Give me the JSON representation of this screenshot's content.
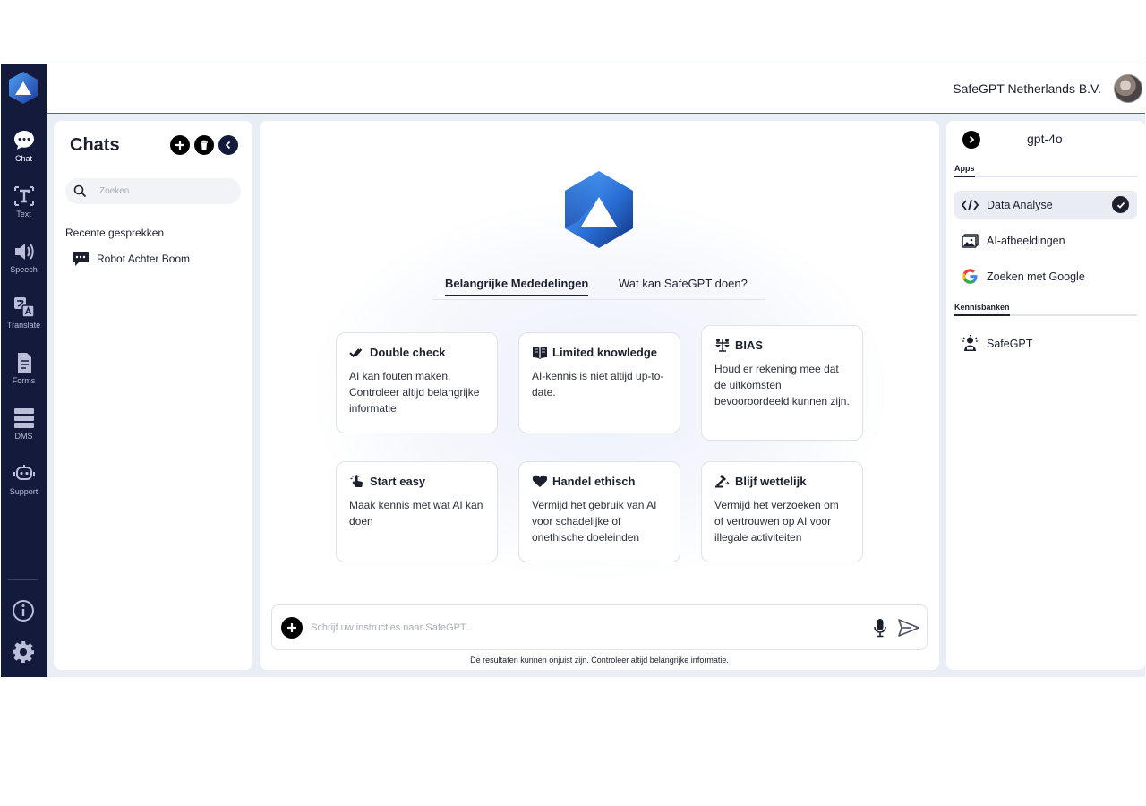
{
  "topbar": {
    "organization": "SafeGPT Netherlands B.V."
  },
  "rail": {
    "items": [
      {
        "label": "Chat",
        "icon": "chat-bubble-icon"
      },
      {
        "label": "Text",
        "icon": "text-icon"
      },
      {
        "label": "Speech",
        "icon": "speaker-icon"
      },
      {
        "label": "Translate",
        "icon": "translate-icon"
      },
      {
        "label": "Forms",
        "icon": "form-document-icon"
      },
      {
        "label": "DMS",
        "icon": "database-icon"
      },
      {
        "label": "Support",
        "icon": "support-robot-icon"
      }
    ],
    "bottom": [
      "info-icon",
      "gear-icon"
    ]
  },
  "chats": {
    "title": "Chats",
    "search_placeholder": "Zoeken",
    "recent_heading": "Recente gesprekken",
    "conversations": [
      {
        "title": "Robot Achter Boom"
      }
    ]
  },
  "main": {
    "tabs": [
      {
        "label": "Belangrijke Mededelingen",
        "active": true
      },
      {
        "label": "Wat kan SafeGPT doen?",
        "active": false
      }
    ],
    "cards": [
      {
        "title": "Double check",
        "body": "AI kan fouten maken. Controleer altijd belangrijke informatie.",
        "icon": "double-check-icon"
      },
      {
        "title": "Limited knowledge",
        "body": "AI-kennis is niet altijd up-to-date.",
        "icon": "book-icon"
      },
      {
        "title": "BIAS",
        "body": "Houd er rekening mee dat de uitkomsten bevooroordeeld kunnen zijn.",
        "icon": "scale-people-icon"
      },
      {
        "title": "Start easy",
        "body": "Maak kennis met wat AI kan doen",
        "icon": "tap-hand-icon"
      },
      {
        "title": "Handel ethisch",
        "body": "Vermijd het gebruik van AI voor schadelijke of onethische doeleinden",
        "icon": "heart-icon"
      },
      {
        "title": "Blijf wettelijk",
        "body": "Vermijd het verzoeken om of vertrouwen op AI voor illegale activiteiten",
        "icon": "gavel-icon"
      }
    ],
    "composer_placeholder": "Schrijf uw instructies naar SafeGPT...",
    "disclaimer": "De resultaten kunnen onjuist zijn. Controleer altijd belangrijke informatie."
  },
  "right": {
    "model": "gpt-4o",
    "apps_heading": "Apps",
    "apps": [
      {
        "label": "Data Analyse",
        "icon": "code-icon",
        "selected": true
      },
      {
        "label": "AI-afbeeldingen",
        "icon": "image-icon",
        "selected": false
      },
      {
        "label": "Zoeken met Google",
        "icon": "google-icon",
        "selected": false
      }
    ],
    "kb_heading": "Kennisbanken",
    "knowledge_bases": [
      {
        "label": "SafeGPT",
        "icon": "knowledge-person-icon"
      }
    ]
  },
  "colors": {
    "rail": "#141a3c",
    "accent": "#1c1f2e",
    "brand_blue": "#2a6fd6"
  }
}
